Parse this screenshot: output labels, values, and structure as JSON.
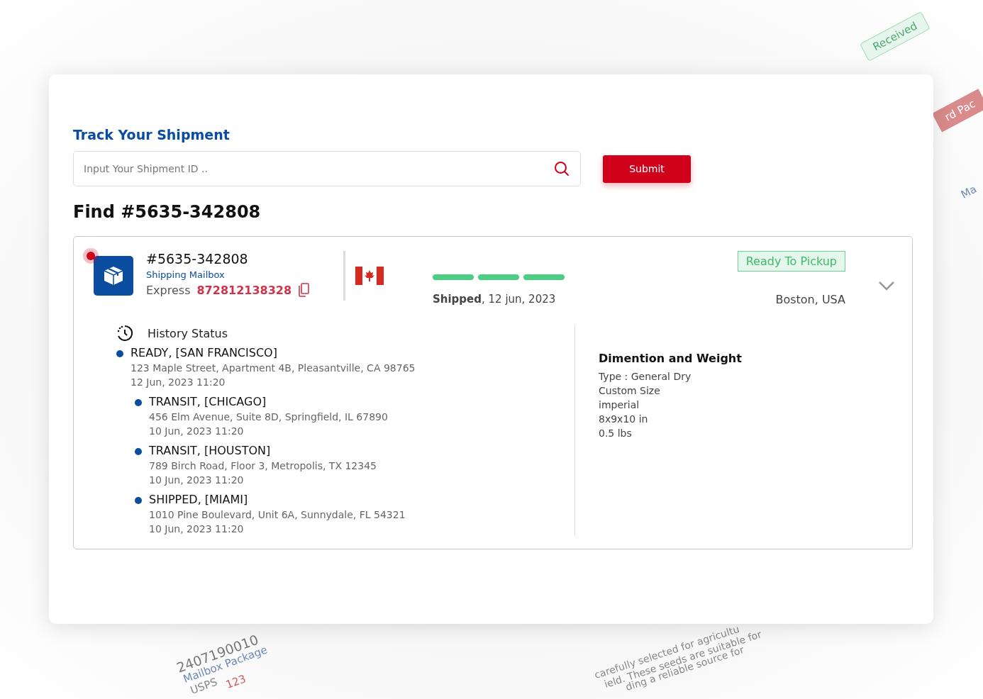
{
  "background": [
    {
      "kind": "badge-green",
      "text": "Received"
    },
    {
      "kind": "badge-red",
      "text": "rd Pac"
    },
    {
      "kind": "link",
      "text": "Ma"
    },
    {
      "kind": "id",
      "text": "2407190010"
    },
    {
      "kind": "link",
      "text": "Mailbox Package"
    },
    {
      "kind": "label",
      "text": "USPS"
    },
    {
      "kind": "label-red",
      "text": "123"
    },
    {
      "kind": "body",
      "text": "carefully selected for agricultu"
    },
    {
      "kind": "body",
      "text": "ield. These seeds are suitable for"
    },
    {
      "kind": "body",
      "text": "ding a reliable source for"
    }
  ],
  "tracker": {
    "title": "Track Your Shipment",
    "search": {
      "placeholder": "Input Your Shipment ID .."
    },
    "submit": "Submit"
  },
  "result_heading": "Find #5635-342808",
  "shipment": {
    "id": "#5635-342808",
    "type": "Shipping Mailbox",
    "service": "Express",
    "tracking_number": "872812138328",
    "alert": true,
    "progress": [
      {
        "done": true
      },
      {
        "done": true
      },
      {
        "done": true
      }
    ],
    "shipped": "**Shipped**, 12 jun, 2023",
    "status": "Ready To Pickup",
    "destination": "Boston, USA",
    "expanded": true
  },
  "history": {
    "title": "History Status",
    "events": [
      {
        "status": "READY, [SAN FRANCISCO]",
        "address": "123 Maple Street, Apartment 4B, Pleasantville, CA 98765",
        "time": "12 Jun, 2023 11:20",
        "children": [
          {
            "status": "TRANSIT, [CHICAGO]",
            "address": "456 Elm Avenue, Suite 8D, Springfield, IL 67890",
            "time": "10 Jun, 2023 11:20"
          },
          {
            "status": "TRANSIT, [HOUSTON]",
            "address": "789 Birch Road, Floor 3, Metropolis, TX 12345",
            "time": "10 Jun, 2023 11:20"
          },
          {
            "status": "SHIPPED, [MIAMI]",
            "address": "1010 Pine Boulevard, Unit 6A, Sunnydale, FL 54321",
            "time": "10 Jun, 2023 11:20"
          }
        ]
      }
    ]
  },
  "dimensions": {
    "title": "Dimention and Weight",
    "lines": [
      "Type : General Dry",
      "Custom Size",
      "imperial",
      "8x9x10 in",
      "0.5 lbs"
    ]
  }
}
